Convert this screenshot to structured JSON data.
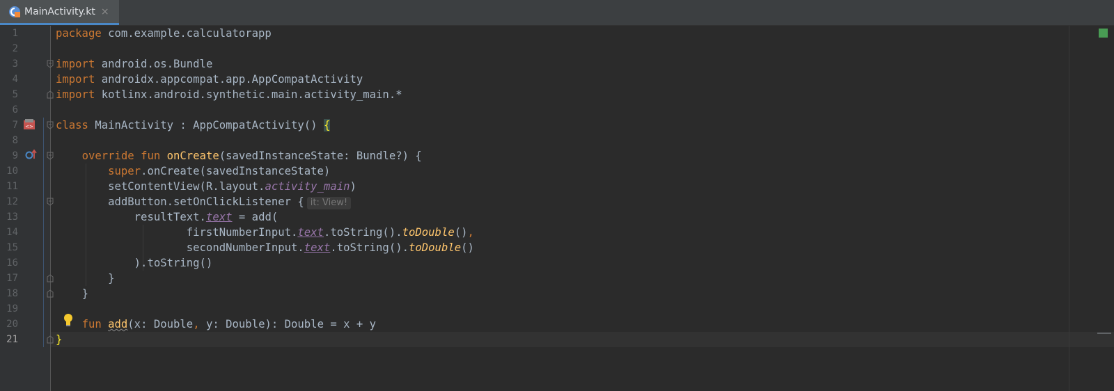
{
  "tab": {
    "title": "MainActivity.kt",
    "close": "×"
  },
  "hint": "it: View!",
  "line_numbers": [
    "1",
    "2",
    "3",
    "4",
    "5",
    "6",
    "7",
    "8",
    "9",
    "10",
    "11",
    "12",
    "13",
    "14",
    "15",
    "16",
    "17",
    "18",
    "19",
    "20",
    "21"
  ],
  "code": {
    "l1_kw": "package",
    "l1_rest": " com.example.calculatorapp",
    "l3_kw": "import",
    "l3_rest": " android.os.Bundle",
    "l4_kw": "import",
    "l4_rest": " androidx.appcompat.app.AppCompatActivity",
    "l5_kw": "import",
    "l5_rest": " kotlinx.android.synthetic.main.activity_main.*",
    "l7_kw": "class",
    "l7_rest": " MainActivity : AppCompatActivity() ",
    "l7_brace": "{",
    "l9_kw1": "override",
    "l9_kw2": "fun",
    "l9_fn": "onCreate",
    "l9_rest": "(savedInstanceState: Bundle?) {",
    "l10_kw": "super",
    "l10_rest": ".onCreate(savedInstanceState)",
    "l11_a": "setContentView(R.layout.",
    "l11_prop": "activity_main",
    "l11_b": ")",
    "l12_a": "addButton.setOnClickListener {",
    "l13_a": "resultText.",
    "l13_prop": "text",
    "l13_b": " = add(",
    "l14_a": "firstNumberInput.",
    "l14_prop": "text",
    "l14_b": ".toString().",
    "l14_ext": "toDouble",
    "l14_c": "()",
    "l14_comma": ",",
    "l15_a": "secondNumberInput.",
    "l15_prop": "text",
    "l15_b": ".toString().",
    "l15_ext": "toDouble",
    "l15_c": "()",
    "l16_a": ").toString()",
    "l17_a": "}",
    "l18_a": "}",
    "l20_kw": "fun",
    "l20_fn": "add",
    "l20_a": "(x: Double",
    "l20_comma": ",",
    "l20_b": " y: Double): Double = x + y",
    "l21_a": "}"
  }
}
